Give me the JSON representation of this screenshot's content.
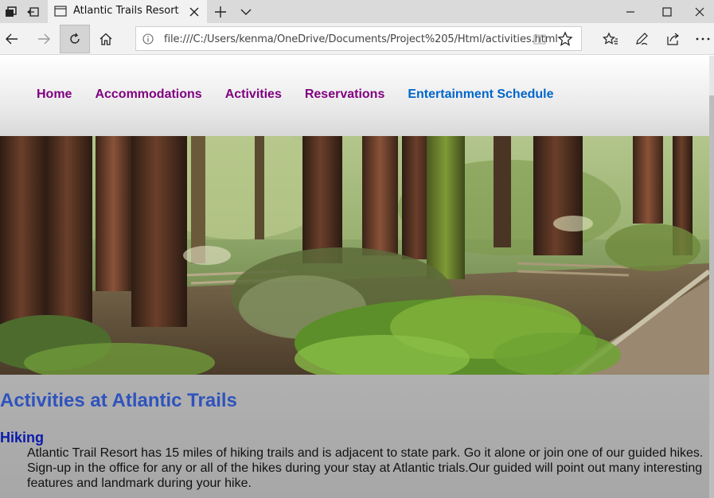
{
  "browser": {
    "tab_title": "Atlantic Trails Resort",
    "url": "file:///C:/Users/kenma/OneDrive/Documents/Project%205/Html/activities.html",
    "icons": {
      "tab_actions": "tab-actions-icon",
      "set_aside": "set-aside-tabs-icon",
      "page": "page-icon",
      "close": "close-icon",
      "new_tab": "plus-icon",
      "tab_list": "chevron-down-icon",
      "minimize": "minimize-icon",
      "maximize": "maximize-icon",
      "window_close": "close-icon",
      "back": "back-arrow-icon",
      "forward": "forward-arrow-icon",
      "refresh": "refresh-icon",
      "home": "home-icon",
      "info": "info-icon",
      "reading_view": "reading-view-icon",
      "favorite": "star-icon",
      "favorites_hub": "favorites-list-icon",
      "notes": "pen-icon",
      "share": "share-icon",
      "more": "more-dots-icon"
    }
  },
  "site_nav": {
    "items": [
      {
        "label": "Home"
      },
      {
        "label": "Accommodations"
      },
      {
        "label": "Activities"
      },
      {
        "label": "Reservations"
      },
      {
        "label": "Entertainment Schedule"
      }
    ],
    "visited_color": "#800080",
    "current_color": "#0066cc"
  },
  "page": {
    "title": "Activities at Atlantic Trails",
    "sections": [
      {
        "heading": "Hiking",
        "text": "Atlantic Trail Resort has 15 miles of hiking trails and is adjacent to state park. Go it alone or join one of our guided hikes. Sign-up in the office for any or all of the hikes during your stay at Atlantic trials.Our guided will point out many interesting features and landmark during your hike."
      }
    ],
    "title_color": "#2f53bd",
    "heading_color": "#0a1bab"
  }
}
